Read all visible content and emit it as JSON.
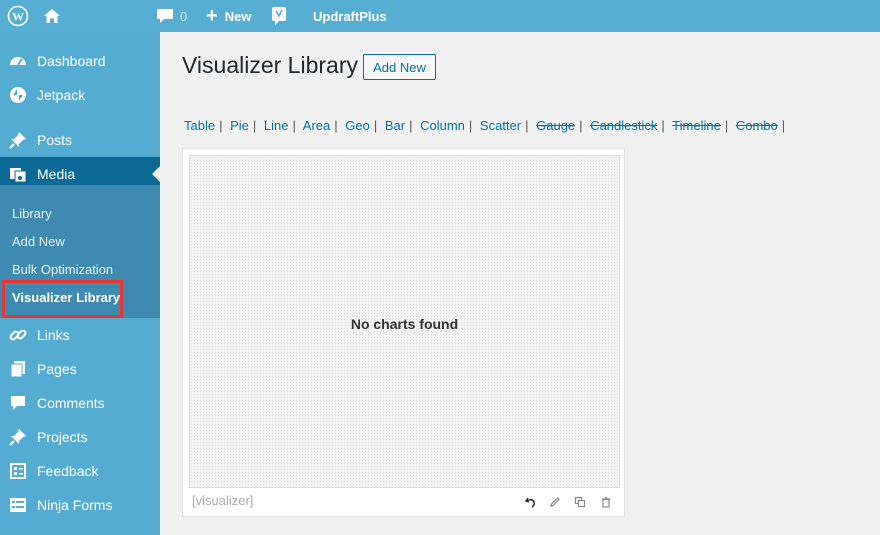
{
  "adminbar": {
    "comments_count": "0",
    "new_label": "New",
    "updraft_label": "UpdraftPlus"
  },
  "sidebar": {
    "items": [
      {
        "label": "Dashboard",
        "icon": "dashboard-icon"
      },
      {
        "label": "Jetpack",
        "icon": "jetpack-icon"
      },
      {
        "label": "Posts",
        "icon": "pin-icon"
      },
      {
        "label": "Media",
        "icon": "media-icon"
      },
      {
        "label": "Links",
        "icon": "link-icon"
      },
      {
        "label": "Pages",
        "icon": "pages-icon"
      },
      {
        "label": "Comments",
        "icon": "comment-icon"
      },
      {
        "label": "Projects",
        "icon": "pin-icon"
      },
      {
        "label": "Feedback",
        "icon": "feedback-icon"
      },
      {
        "label": "Ninja Forms",
        "icon": "forms-icon"
      }
    ],
    "submenu": [
      "Library",
      "Add New",
      "Bulk Optimization",
      "Visualizer Library"
    ]
  },
  "main": {
    "title": "Visualizer Library",
    "add_new": "Add New",
    "chart_types": [
      {
        "label": "Table",
        "enabled": true
      },
      {
        "label": "Pie",
        "enabled": true
      },
      {
        "label": "Line",
        "enabled": true
      },
      {
        "label": "Area",
        "enabled": true
      },
      {
        "label": "Geo",
        "enabled": true
      },
      {
        "label": "Bar",
        "enabled": true
      },
      {
        "label": "Column",
        "enabled": true
      },
      {
        "label": "Scatter",
        "enabled": true
      },
      {
        "label": "Gauge",
        "enabled": false
      },
      {
        "label": "Candlestick",
        "enabled": false
      },
      {
        "label": "Timeline",
        "enabled": false
      },
      {
        "label": "Combo",
        "enabled": false
      }
    ],
    "empty_message": "No charts found",
    "shortcode": "[visualizer]"
  },
  "colors": {
    "adminbar": "#56aed3",
    "sidebar": "#54acd2",
    "sidebar_current": "#0b6995",
    "submenu": "#3e8ab1",
    "highlight": "#e53935",
    "link": "#0073aa"
  }
}
